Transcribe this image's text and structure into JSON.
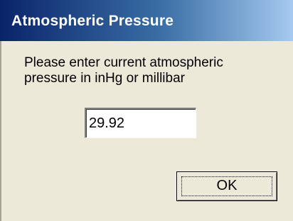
{
  "window": {
    "title": "Atmospheric Pressure"
  },
  "dialog": {
    "prompt": "Please enter current atmospheric\npressure in inHg or millibar",
    "pressure_value": "29.92",
    "ok_label": "OK"
  },
  "colors": {
    "titlebar_start": "#0a246a",
    "titlebar_end": "#a6caf0",
    "dialog_background": "#ece9d8"
  }
}
